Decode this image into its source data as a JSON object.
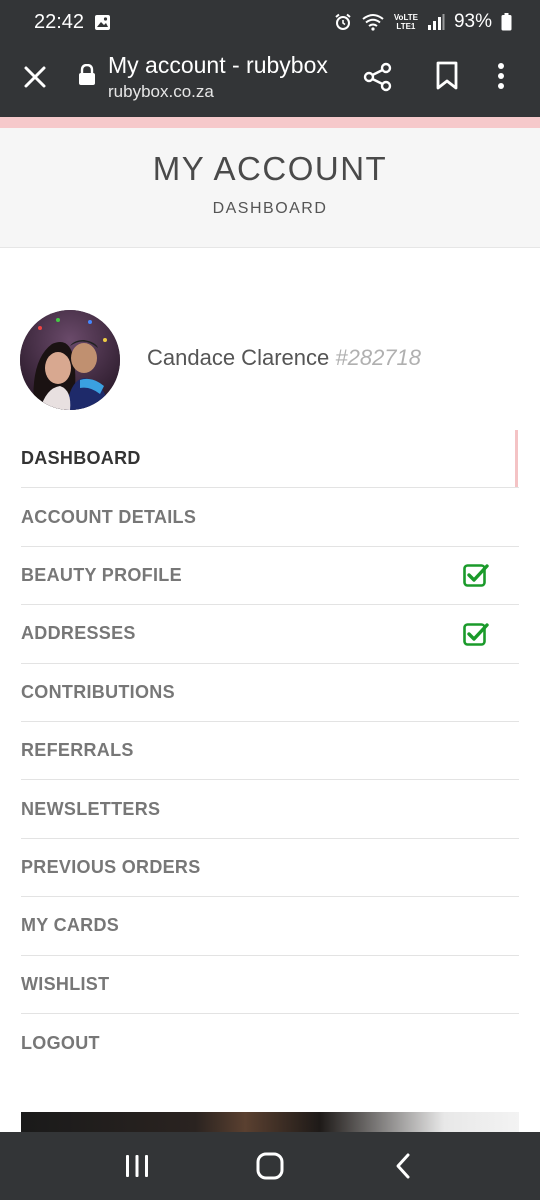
{
  "status_bar": {
    "time": "22:42",
    "network_label": "LTE1",
    "volte_label": "VoLTE",
    "battery": "93%"
  },
  "browser": {
    "title": "My account - rubybox",
    "url": "rubybox.co.za",
    "icons": [
      "close-icon",
      "lock-icon",
      "share-icon",
      "bookmark-icon",
      "more-icon"
    ]
  },
  "header": {
    "title": "MY ACCOUNT",
    "subtitle": "DASHBOARD"
  },
  "profile": {
    "name": "Candace Clarence",
    "id": "#282718"
  },
  "menu": {
    "items": [
      {
        "label": "DASHBOARD",
        "active": true,
        "checked": false
      },
      {
        "label": "ACCOUNT DETAILS",
        "active": false,
        "checked": false
      },
      {
        "label": "BEAUTY PROFILE",
        "active": false,
        "checked": true
      },
      {
        "label": "ADDRESSES",
        "active": false,
        "checked": true
      },
      {
        "label": "CONTRIBUTIONS",
        "active": false,
        "checked": false
      },
      {
        "label": "REFERRALS",
        "active": false,
        "checked": false
      },
      {
        "label": "NEWSLETTERS",
        "active": false,
        "checked": false
      },
      {
        "label": "PREVIOUS ORDERS",
        "active": false,
        "checked": false
      },
      {
        "label": "MY CARDS",
        "active": false,
        "checked": false
      },
      {
        "label": "WISHLIST",
        "active": false,
        "checked": false
      },
      {
        "label": "LOGOUT",
        "active": false,
        "checked": false
      }
    ]
  },
  "colors": {
    "chrome": "#333537",
    "accent_pink": "#f6c9cb",
    "check_green": "#1a9a2a",
    "menu_text": "#777777",
    "menu_text_active": "#333333"
  },
  "nav": {
    "icons": [
      "recent-apps-icon",
      "home-icon",
      "back-icon"
    ]
  }
}
